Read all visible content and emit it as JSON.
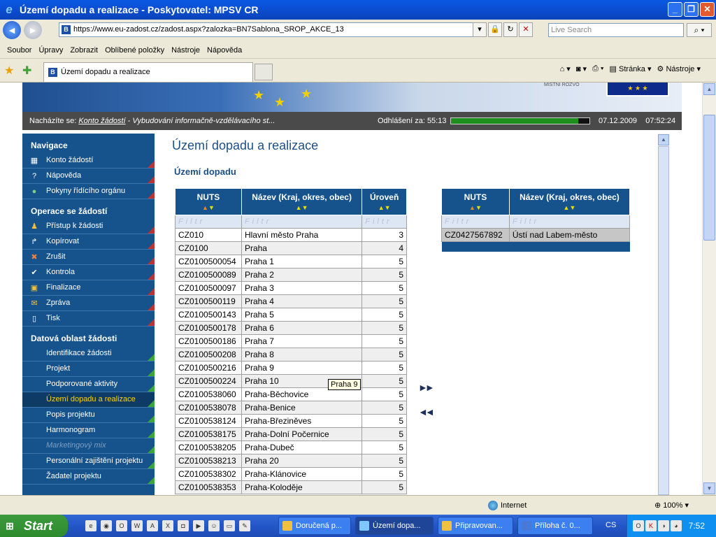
{
  "window": {
    "title": "Území dopadu a realizace - Poskytovatel: MPSV CR"
  },
  "address": {
    "url": "https://www.eu-zadost.cz/zadost.aspx?zalozka=BN7Sablona_SROP_AKCE_13",
    "search_placeholder": "Live Search"
  },
  "menu": [
    "Soubor",
    "Úpravy",
    "Zobrazit",
    "Oblíbené položky",
    "Nástroje",
    "Nápověda"
  ],
  "tab": {
    "label": "Území dopadu a realizace"
  },
  "toolbar": {
    "page": "Stránka",
    "tools": "Nástroje"
  },
  "info": {
    "crumb_prefix": "Nacházíte se:",
    "crumb_link": "Konto žádostí",
    "crumb_rest": "- Vybudování informačně-vzdělávacího st...",
    "logout_label": "Odhlášení za:",
    "logout_time": "55:13",
    "session_progress": 0.92,
    "date": "07.12.2009",
    "time": "07:52:24"
  },
  "banner": {
    "eu_label": "★ ★ ★",
    "ministry": "MÍSTNÍ ROZVO"
  },
  "sidebar": {
    "nav_head": "Navigace",
    "nav": [
      "Konto žádostí",
      "Nápověda",
      "Pokyny řídícího orgánu"
    ],
    "ops_head": "Operace se žádostí",
    "ops": [
      "Přístup k žádosti",
      "Kopírovat",
      "Zrušit",
      "Kontrola",
      "Finalizace",
      "Zpráva",
      "Tisk"
    ],
    "data_head": "Datová oblast žádosti",
    "data": [
      "Identifikace žádosti",
      "Projekt",
      "Podporované aktivity",
      "Území dopadu a realizace",
      "Popis projektu",
      "Harmonogram",
      "Marketingový mix",
      "Personální zajištění projektu",
      "Žadatel projektu"
    ]
  },
  "main": {
    "title": "Území dopadu a realizace",
    "subtitle": "Území dopadu",
    "filter_text": "Filtr",
    "left_table": {
      "columns": [
        "NUTS",
        "Název (Kraj, okres, obec)",
        "Úroveň"
      ],
      "rows": [
        [
          "CZ010",
          "Hlavní město Praha",
          "3"
        ],
        [
          "CZ0100",
          "Praha",
          "4"
        ],
        [
          "CZ0100500054",
          "Praha 1",
          "5"
        ],
        [
          "CZ0100500089",
          "Praha 2",
          "5"
        ],
        [
          "CZ0100500097",
          "Praha 3",
          "5"
        ],
        [
          "CZ0100500119",
          "Praha 4",
          "5"
        ],
        [
          "CZ0100500143",
          "Praha 5",
          "5"
        ],
        [
          "CZ0100500178",
          "Praha 6",
          "5"
        ],
        [
          "CZ0100500186",
          "Praha 7",
          "5"
        ],
        [
          "CZ0100500208",
          "Praha 8",
          "5"
        ],
        [
          "CZ0100500216",
          "Praha 9",
          "5"
        ],
        [
          "CZ0100500224",
          "Praha 10",
          "5"
        ],
        [
          "CZ0100538060",
          "Praha-Běchovice",
          "5"
        ],
        [
          "CZ0100538078",
          "Praha-Benice",
          "5"
        ],
        [
          "CZ0100538124",
          "Praha-Březiněves",
          "5"
        ],
        [
          "CZ0100538175",
          "Praha-Dolní Počernice",
          "5"
        ],
        [
          "CZ0100538205",
          "Praha-Dubeč",
          "5"
        ],
        [
          "CZ0100538213",
          "Praha 20",
          "5"
        ],
        [
          "CZ0100538302",
          "Praha-Klánovice",
          "5"
        ],
        [
          "CZ0100538353",
          "Praha-Koloděje",
          "5"
        ]
      ]
    },
    "right_table": {
      "columns": [
        "NUTS",
        "Název (Kraj, okres, obec)"
      ],
      "rows": [
        [
          "CZ0427567892",
          "Ústí nad Labem-město"
        ]
      ]
    },
    "add_arrow": "►►",
    "remove_arrow": "◄◄",
    "tooltip": "Praha 9"
  },
  "status": {
    "zone": "Internet",
    "zoom": "100%"
  },
  "taskbar": {
    "start": "Start",
    "tasks": [
      "Doručená p...",
      "Území dopa...",
      "Připravovan...",
      "Příloha č. 0..."
    ],
    "lang": "CS",
    "clock": "7:52"
  }
}
